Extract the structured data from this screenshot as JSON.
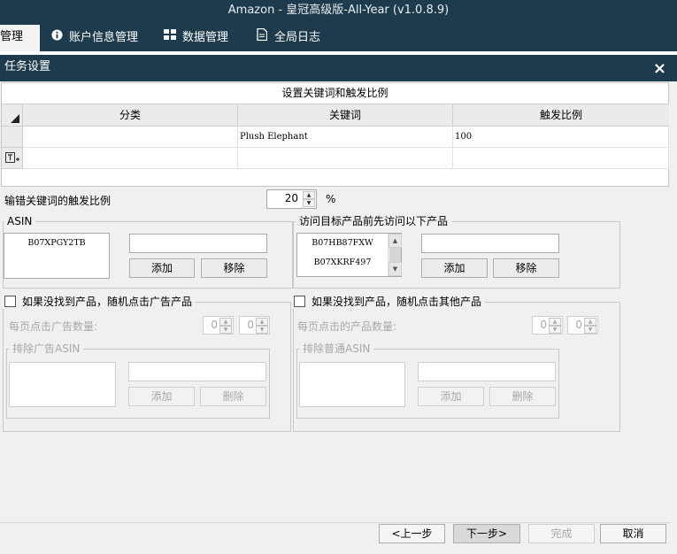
{
  "window": {
    "title": "Amazon - 皇冠高级版-All-Year  (v1.0.8.9)"
  },
  "nav": {
    "tabs": [
      {
        "label": "管理",
        "icon": ""
      },
      {
        "label": "账户信息管理",
        "icon": "info-circle-icon",
        "glyph": "❶"
      },
      {
        "label": "数据管理",
        "icon": "grid-icon",
        "glyph": "▦"
      },
      {
        "label": "全局日志",
        "icon": "document-icon",
        "glyph": "🗎"
      }
    ]
  },
  "dialog": {
    "title": "任务设置",
    "close": "×"
  },
  "keywords": {
    "caption": "设置关键词和触发比例",
    "columns": [
      "分类",
      "关键词",
      "触发比例"
    ],
    "rows": [
      {
        "category": "",
        "keyword": "Plush Elephant",
        "ratio": "100"
      }
    ]
  },
  "error_ratio": {
    "label": "输错关键词的触发比例",
    "value": "20",
    "unit": "%"
  },
  "asin_group": {
    "title": "ASIN",
    "items": [
      "B07XPGY2TB"
    ],
    "input": "",
    "add": "添加",
    "remove": "移除"
  },
  "visit_group": {
    "title": "访问目标产品前先访问以下产品",
    "items": [
      "B07HB87FXW",
      "B07XKRF497"
    ],
    "input": "",
    "add": "添加",
    "remove": "移除"
  },
  "ad_group": {
    "checkbox_label": "如果没找到产品，随机点击广告产品",
    "per_page_label": "每页点击广告数量:",
    "min": "0",
    "max": "0",
    "exclude_title": "排除广告ASIN",
    "input": "",
    "add": "添加",
    "delete": "删除"
  },
  "other_group": {
    "checkbox_label": "如果没找到产品，随机点击其他产品",
    "per_page_label": "每页点击的产品数量:",
    "min": "0",
    "max": "0",
    "exclude_title": "排除普通ASIN",
    "input": "",
    "add": "添加",
    "delete": "删除"
  },
  "footer": {
    "prev": "<上一步",
    "next": "下一步>",
    "finish": "完成",
    "cancel": "取消"
  },
  "colors": {
    "titlebar": "#1d3b4c",
    "dialog_bg": "#f0f0f0",
    "selected_button": "#d9d9d9"
  }
}
